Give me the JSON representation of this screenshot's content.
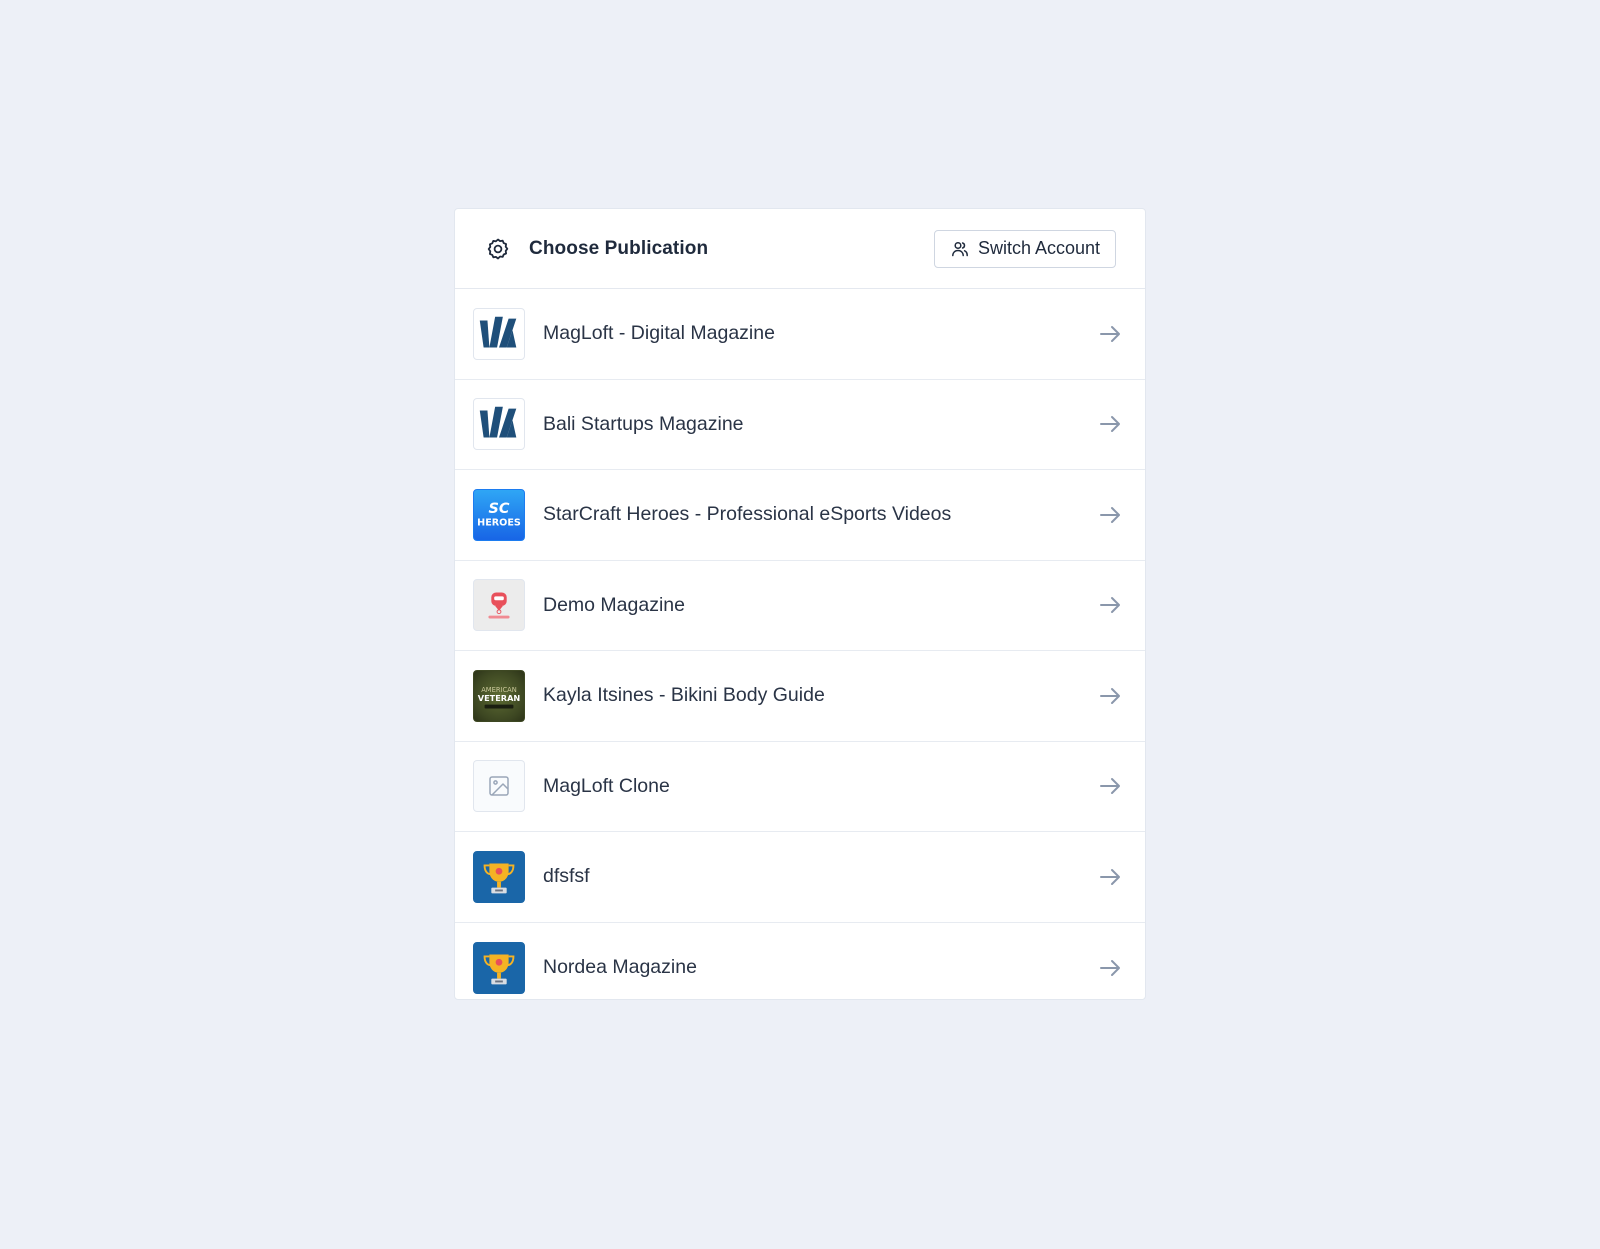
{
  "header": {
    "title": "Choose Publication",
    "icon": "gear-icon",
    "switch_account_label": "Switch Account",
    "switch_account_icon": "users-icon"
  },
  "publications": [
    {
      "name": "MagLoft - Digital Magazine",
      "thumb": "magloft-logo"
    },
    {
      "name": "Bali Startups Magazine",
      "thumb": "magloft-logo"
    },
    {
      "name": "StarCraft Heroes - Professional eSports Videos",
      "thumb": "sc-heroes-logo",
      "thumb_text": "SC HEROES"
    },
    {
      "name": "Demo Magazine",
      "thumb": "demo-magazine-logo"
    },
    {
      "name": "Kayla Itsines - Bikini Body Guide",
      "thumb": "american-veteran-logo",
      "thumb_text": "AMERICAN VETERAN"
    },
    {
      "name": "MagLoft Clone",
      "thumb": "image-placeholder-icon"
    },
    {
      "name": "dfsfsf",
      "thumb": "trophy-logo"
    },
    {
      "name": "Nordea Magazine",
      "thumb": "trophy-logo"
    }
  ],
  "colors": {
    "background": "#edf0f7",
    "card": "#ffffff",
    "arrow": "#8a97ab",
    "magloft_blue": "#1f4f7a",
    "sc_blue": "#1c7cf0",
    "veteran_green": "#4b5a2a",
    "trophy_bg": "#1a66a8"
  }
}
